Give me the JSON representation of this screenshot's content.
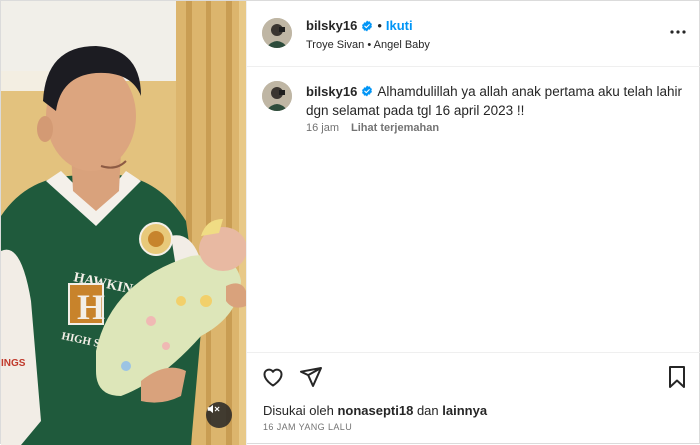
{
  "post": {
    "username": "bilsky16",
    "separator": "•",
    "follow_label": "Ikuti",
    "audio": "Troye Sivan • Angel Baby",
    "caption": "Alhamdulillah ya allah anak pertama aku telah lahir dgn selamat pada tgl 16 april 2023 !!",
    "caption_time": "16 jam",
    "translate_label": "Lihat terjemahan",
    "likes_prefix": "Disukai oleh",
    "likes_user": "nonasepti18",
    "likes_connector": "dan",
    "likes_suffix": "lainnya",
    "posted_ago": "16 JAM YANG LALU"
  },
  "icons": {
    "verified": "verified-badge-icon",
    "more": "more-options-icon",
    "like": "heart-icon",
    "share": "send-icon",
    "save": "bookmark-icon",
    "mute": "muted-speaker-icon"
  },
  "colors": {
    "link": "#0095f6",
    "text": "#262626",
    "muted": "#737373"
  },
  "media": {
    "jacket_text": "HAWKINS",
    "jacket_letter": "H",
    "jacket_subtext": "HIGH SCHOOL",
    "sleeve_text": "INGS"
  }
}
